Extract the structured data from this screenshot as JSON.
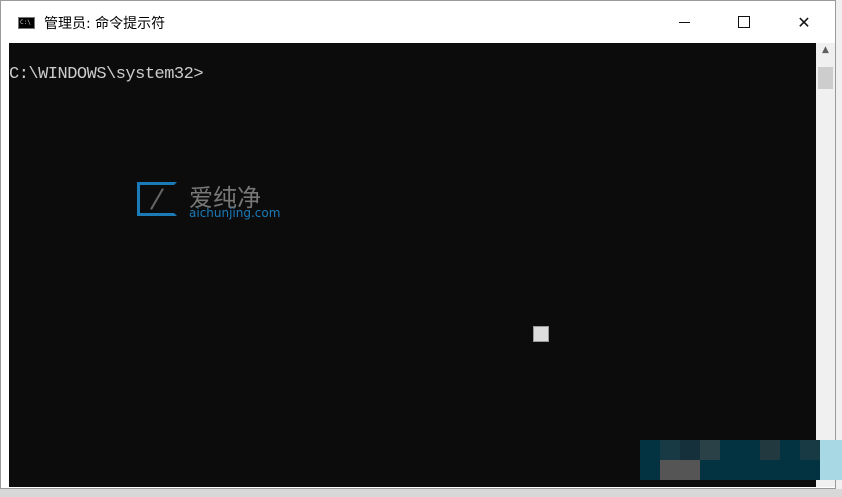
{
  "window": {
    "title": "管理员: 命令提示符",
    "icon": "cmd-icon",
    "controls": [
      "minimize",
      "maximize",
      "close"
    ]
  },
  "console": {
    "prompt": "C:\\WINDOWS\\system32>"
  },
  "watermark": {
    "name_cn": "爱纯净",
    "domain": "aichunjing.com"
  },
  "colors": {
    "console_bg": "#0c0c0c",
    "console_fg": "#cccccc",
    "logo_blue": "#1a7bb8"
  }
}
